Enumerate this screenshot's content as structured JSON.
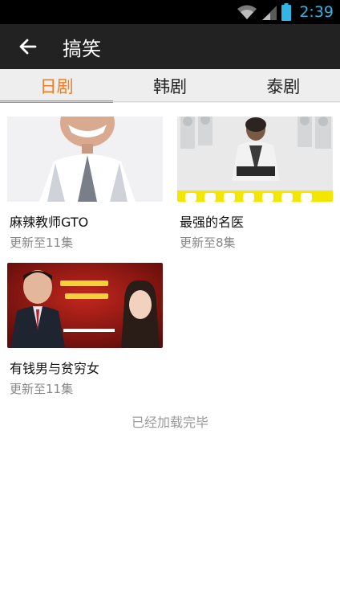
{
  "status_bar": {
    "time": "2:39",
    "icons": [
      "wifi-icon",
      "signal-icon",
      "battery-icon"
    ],
    "time_color": "#33b5e5"
  },
  "action_bar": {
    "back_icon": "arrow-left-icon",
    "title": "搞笑"
  },
  "tabs": [
    {
      "label": "日剧",
      "active": true
    },
    {
      "label": "韩剧",
      "active": false
    },
    {
      "label": "泰剧",
      "active": false
    }
  ],
  "accent_color": "#f07c1f",
  "shows": [
    {
      "title": "麻辣教师GTO",
      "update": "更新至11集"
    },
    {
      "title": "最强的名医",
      "update": "更新至8集"
    },
    {
      "title": "有钱男与贫穷女",
      "update": "更新至11集"
    }
  ],
  "footer": {
    "load_complete": "已经加载完毕"
  }
}
